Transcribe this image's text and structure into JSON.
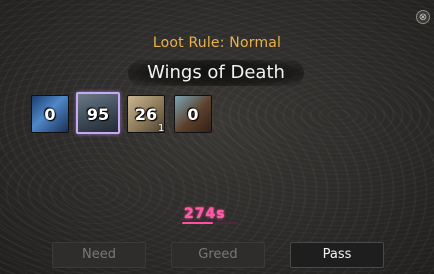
{
  "window": {
    "close_glyph": "⊗"
  },
  "loot": {
    "rule": "Loot Rule: Normal",
    "item_name": "Wings of Death"
  },
  "rewards": [
    {
      "icon": "blue-orb-icon",
      "value": "0"
    },
    {
      "icon": "weapon-icon",
      "value": "95",
      "selected": true
    },
    {
      "icon": "scroll-icon",
      "value": "26",
      "badge": "1"
    },
    {
      "icon": "tool-icon",
      "value": "0"
    }
  ],
  "timer": {
    "text": "274s",
    "progress": 0.55,
    "color": "#ff4fa0"
  },
  "buttons": {
    "need": "Need",
    "greed": "Greed",
    "pass": "Pass"
  },
  "colors": {
    "loot_rule": "#e9b24a",
    "selection": "#c7a9f0"
  }
}
